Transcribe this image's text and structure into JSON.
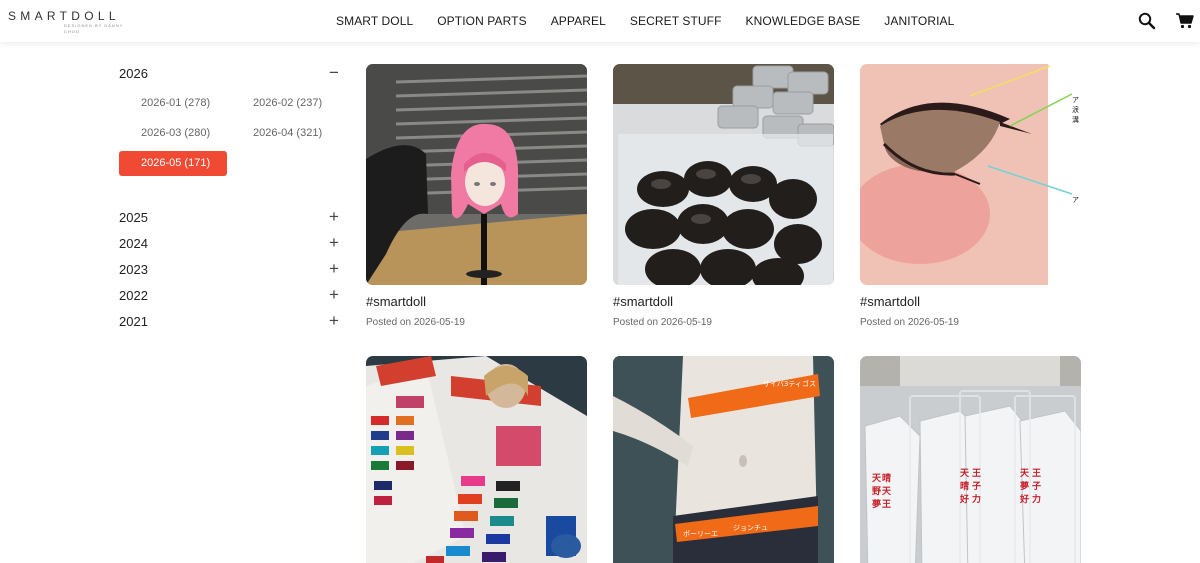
{
  "header": {
    "logo": "SMARTDOLL",
    "logo_tagline": "DESIGNED BY DANNY CHOO",
    "nav": [
      "SMART DOLL",
      "OPTION PARTS",
      "APPAREL",
      "SECRET STUFF",
      "KNOWLEDGE BASE",
      "JANITORIAL"
    ],
    "icons": {
      "search": "search-icon",
      "cart": "cart-icon"
    }
  },
  "sidebar": {
    "expanded_year": {
      "label": "2026",
      "toggle": "−"
    },
    "months": [
      {
        "label": "2026-01 (278)",
        "active": false
      },
      {
        "label": "2026-02 (237)",
        "active": false
      },
      {
        "label": "2026-03 (280)",
        "active": false
      },
      {
        "label": "2026-04 (321)",
        "active": false
      },
      {
        "label": "2026-05 (171)",
        "active": true
      }
    ],
    "collapsed_years": [
      {
        "label": "2025",
        "toggle": "+"
      },
      {
        "label": "2024",
        "toggle": "+"
      },
      {
        "label": "2023",
        "toggle": "+"
      },
      {
        "label": "2022",
        "toggle": "+"
      },
      {
        "label": "2021",
        "toggle": "+"
      }
    ]
  },
  "posts": [
    {
      "title": "#smartdoll",
      "date": "Posted on 2026-05-19",
      "image": "pink-wig-doll-head"
    },
    {
      "title": "#smartdoll",
      "date": "Posted on 2026-05-19",
      "image": "dark-wigs-in-box"
    },
    {
      "title": "#smartdoll",
      "date": "Posted on 2026-05-19",
      "image": "eye-makeup-diagram"
    },
    {
      "title": "",
      "date": "",
      "image": "fabric-color-swatches"
    },
    {
      "title": "",
      "date": "",
      "image": "doll-torso-with-band"
    },
    {
      "title": "",
      "date": "",
      "image": "shirts-in-bags"
    }
  ],
  "accent_color": "#f04a34"
}
